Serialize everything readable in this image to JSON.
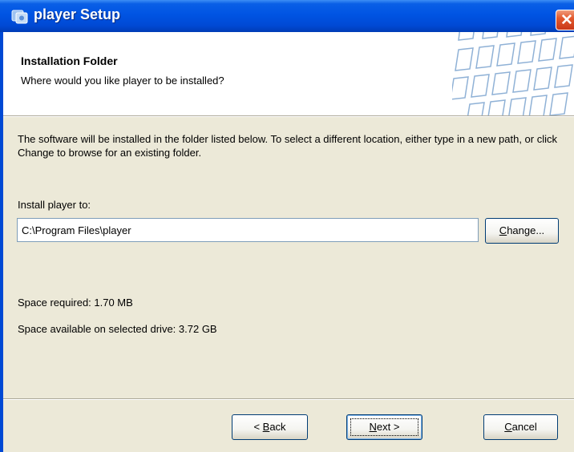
{
  "window": {
    "title": "player Setup",
    "close_icon": "close-icon"
  },
  "header": {
    "title": "Installation Folder",
    "subtitle": "Where would you like player to be installed?",
    "image": "keyboard-keys-graphic"
  },
  "body": {
    "description": "The software will be installed in the folder listed below. To select a different location, either type in a new path, or click Change to browse for an existing folder.",
    "install_label": "Install player to:",
    "install_path": "C:\\Program Files\\player",
    "change_button": {
      "mnemonic": "C",
      "rest": "hange..."
    },
    "space_required": "Space required: 1.70 MB",
    "space_available": "Space available on selected drive: 3.72 GB"
  },
  "footer": {
    "back_button": {
      "prefix": "< ",
      "mnemonic": "B",
      "rest": "ack"
    },
    "next_button": {
      "mnemonic": "N",
      "rest": "ext >"
    },
    "cancel_button": {
      "mnemonic": "C",
      "rest": "ancel"
    }
  },
  "colors": {
    "titlebar": "#0054e3",
    "dialog_bg": "#ece9d8",
    "close_button": "#e35a2e"
  }
}
